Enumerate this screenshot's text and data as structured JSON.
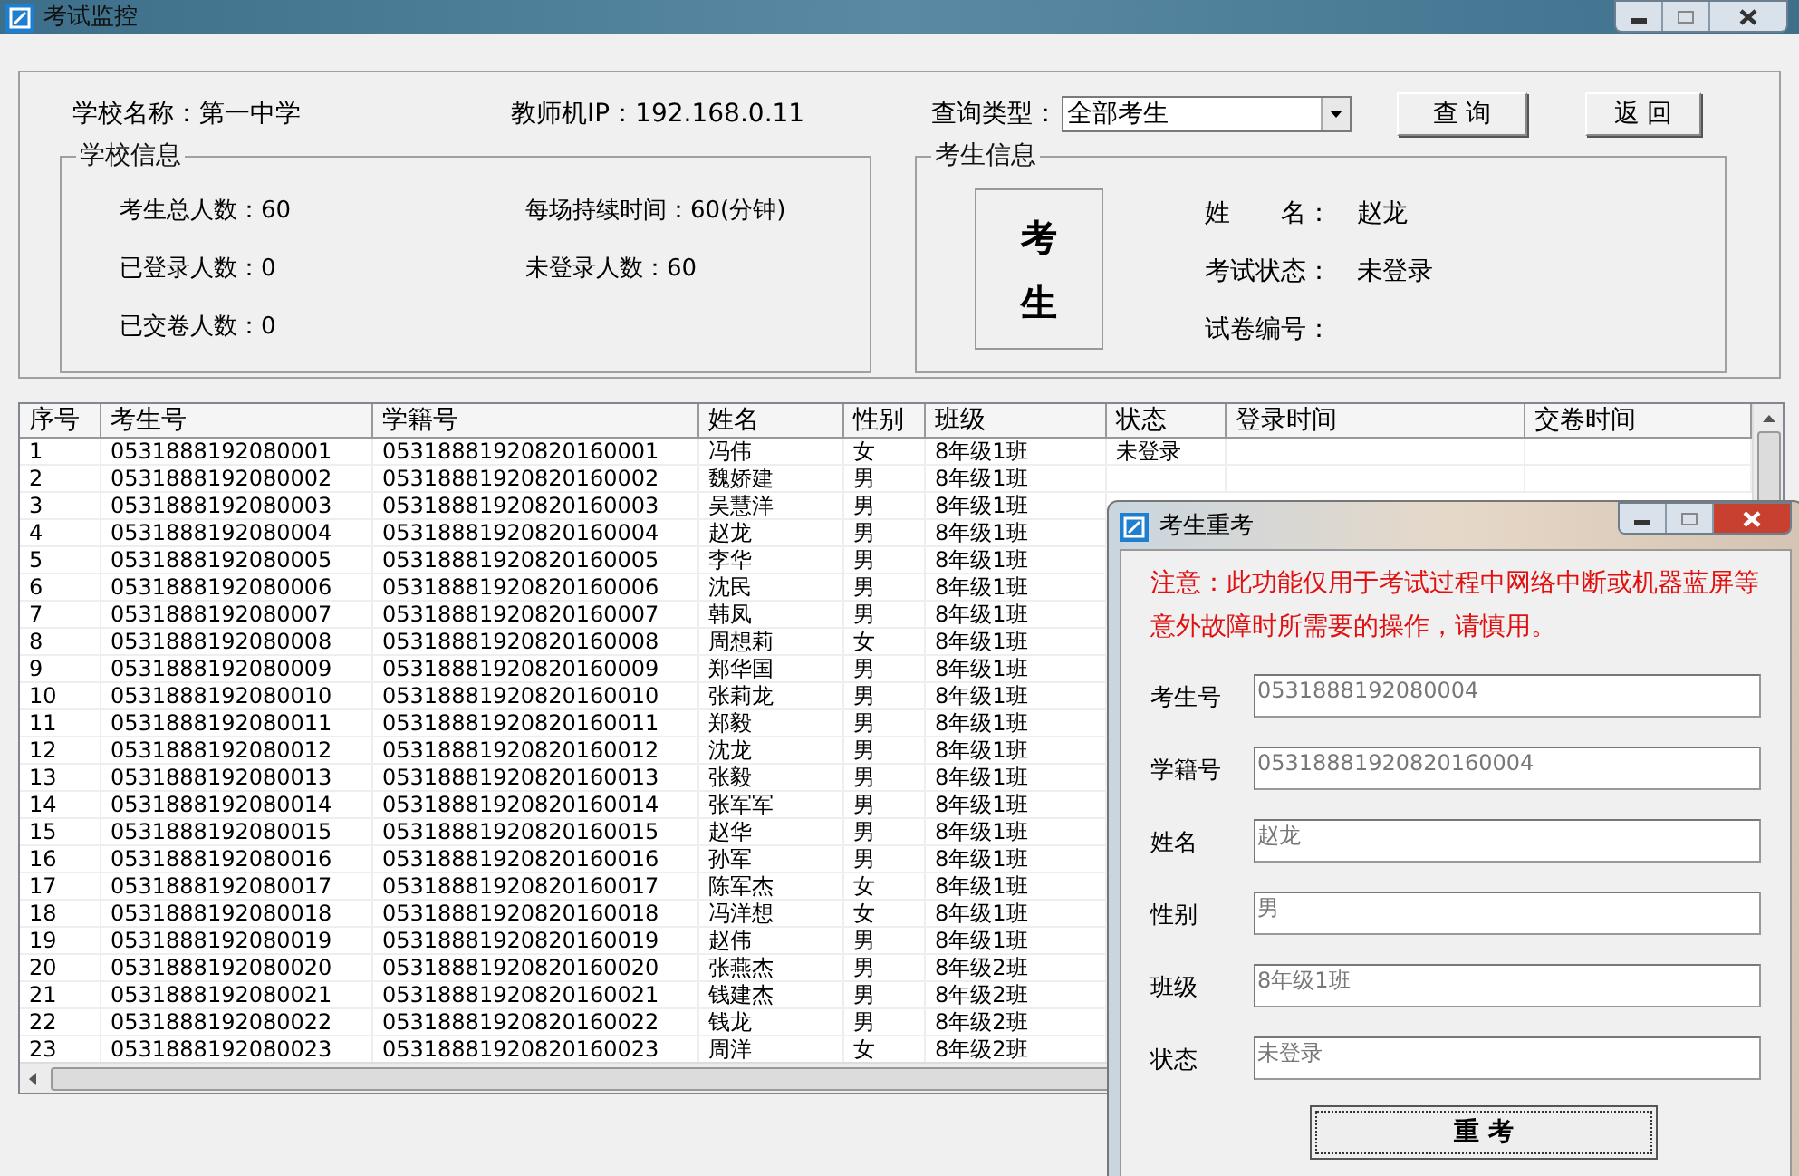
{
  "window": {
    "title": "考试监控"
  },
  "header": {
    "school": "学校名称：第一中学",
    "teacher_ip": "教师机IP：192.168.0.11",
    "query_label": "查询类型：",
    "query_value": "全部考生",
    "buttons": [
      "查 询",
      "返 回"
    ]
  },
  "school_info": {
    "title": "学校信息",
    "stats": [
      "考生总人数：60",
      "每场持续时间：60(分钟)",
      "已登录人数：0",
      "未登录人数：60",
      "已交卷人数：0"
    ]
  },
  "student_info": {
    "title": "考生信息",
    "photo_text": "考生",
    "fields": [
      {
        "label": "姓　　名：",
        "value": "赵龙"
      },
      {
        "label": "考试状态：",
        "value": "未登录"
      },
      {
        "label": "试卷编号："
      }
    ]
  },
  "table": {
    "columns": [
      "序号",
      "考生号",
      "学籍号",
      "姓名",
      "性别",
      "班级",
      "状态",
      "登录时间",
      "交卷时间"
    ],
    "rows": [
      [
        "1",
        "0531888192080001",
        "05318881920820160001",
        "冯伟",
        "女",
        "8年级1班",
        "未登录"
      ],
      [
        "2",
        "0531888192080002",
        "05318881920820160002",
        "魏娇建",
        "男",
        "8年级1班"
      ],
      [
        "3",
        "0531888192080003",
        "05318881920820160003",
        "吴慧洋",
        "男",
        "8年级1班"
      ],
      [
        "4",
        "0531888192080004",
        "05318881920820160004",
        "赵龙",
        "男",
        "8年级1班"
      ],
      [
        "5",
        "0531888192080005",
        "05318881920820160005",
        "李华",
        "男",
        "8年级1班"
      ],
      [
        "6",
        "0531888192080006",
        "05318881920820160006",
        "沈民",
        "男",
        "8年级1班"
      ],
      [
        "7",
        "0531888192080007",
        "05318881920820160007",
        "韩凤",
        "男",
        "8年级1班"
      ],
      [
        "8",
        "0531888192080008",
        "05318881920820160008",
        "周想莉",
        "女",
        "8年级1班"
      ],
      [
        "9",
        "0531888192080009",
        "05318881920820160009",
        "郑华国",
        "男",
        "8年级1班"
      ],
      [
        "10",
        "0531888192080010",
        "05318881920820160010",
        "张莉龙",
        "男",
        "8年级1班"
      ],
      [
        "11",
        "0531888192080011",
        "05318881920820160011",
        "郑毅",
        "男",
        "8年级1班"
      ],
      [
        "12",
        "0531888192080012",
        "05318881920820160012",
        "沈龙",
        "男",
        "8年级1班"
      ],
      [
        "13",
        "0531888192080013",
        "05318881920820160013",
        "张毅",
        "男",
        "8年级1班"
      ],
      [
        "14",
        "0531888192080014",
        "05318881920820160014",
        "张军军",
        "男",
        "8年级1班"
      ],
      [
        "15",
        "0531888192080015",
        "05318881920820160015",
        "赵华",
        "男",
        "8年级1班"
      ],
      [
        "16",
        "0531888192080016",
        "05318881920820160016",
        "孙军",
        "男",
        "8年级1班"
      ],
      [
        "17",
        "0531888192080017",
        "05318881920820160017",
        "陈军杰",
        "女",
        "8年级1班"
      ],
      [
        "18",
        "0531888192080018",
        "05318881920820160018",
        "冯洋想",
        "女",
        "8年级1班"
      ],
      [
        "19",
        "0531888192080019",
        "05318881920820160019",
        "赵伟",
        "男",
        "8年级1班"
      ],
      [
        "20",
        "0531888192080020",
        "05318881920820160020",
        "张燕杰",
        "男",
        "8年级2班"
      ],
      [
        "21",
        "0531888192080021",
        "05318881920820160021",
        "钱建杰",
        "男",
        "8年级2班"
      ],
      [
        "22",
        "0531888192080022",
        "05318881920820160022",
        "钱龙",
        "男",
        "8年级2班"
      ],
      [
        "23",
        "0531888192080023",
        "05318881920820160023",
        "周洋",
        "女",
        "8年级2班"
      ]
    ]
  },
  "dialog": {
    "title": "考生重考",
    "notice": "注意：此功能仅用于考试过程中网络中断或机器蓝屏等意外故障时所需要的操作，请慎用。",
    "fields": [
      {
        "label": "考生号",
        "value": "0531888192080004"
      },
      {
        "label": "学籍号",
        "value": "05318881920820160004"
      },
      {
        "label": "姓名",
        "value": "赵龙"
      },
      {
        "label": "性别",
        "value": "男"
      },
      {
        "label": "班级",
        "value": "8年级1班"
      },
      {
        "label": "状态",
        "value": "未登录"
      }
    ],
    "button": "重 考"
  }
}
